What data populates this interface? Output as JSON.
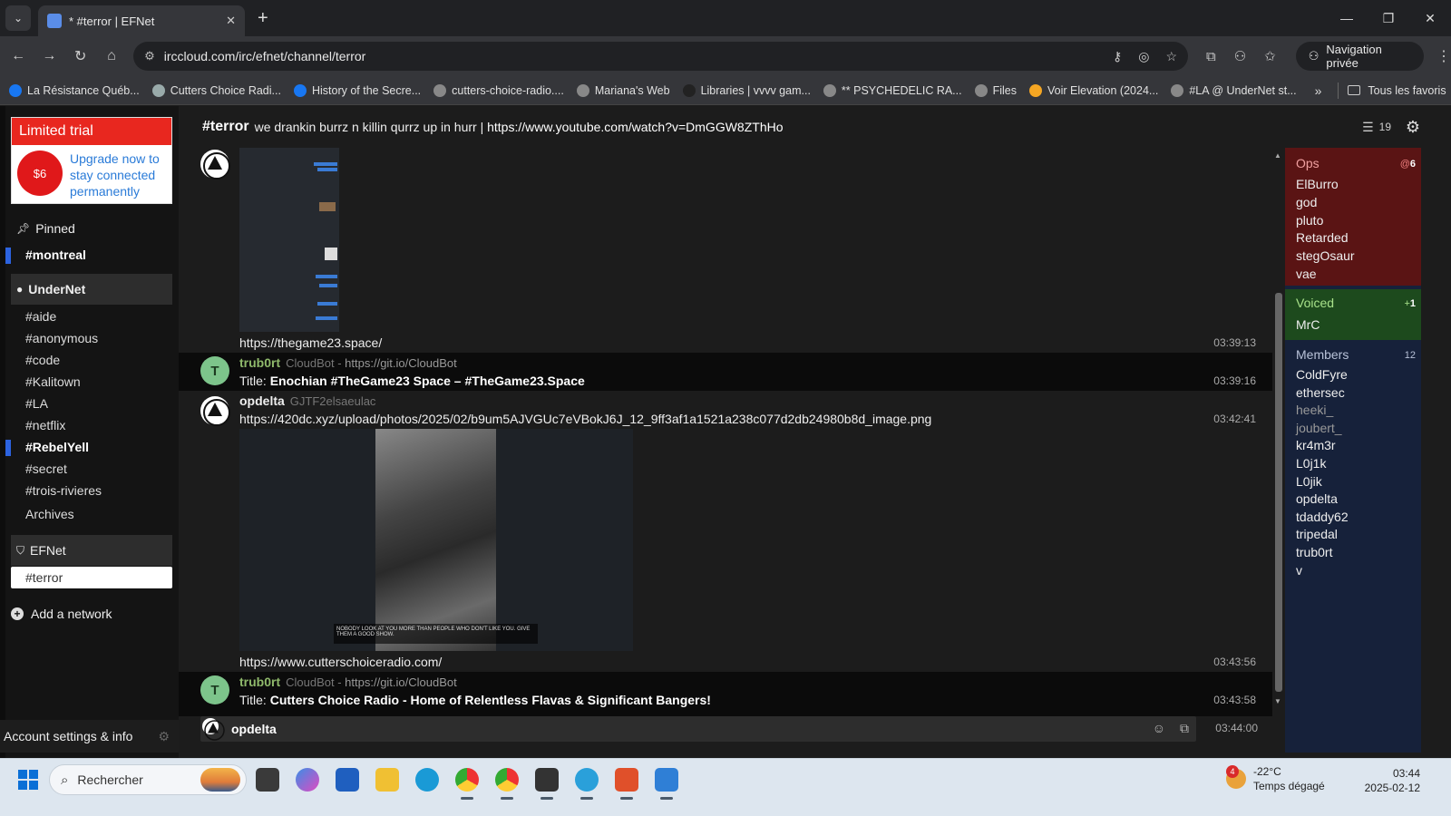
{
  "browser": {
    "tab_title": "* #terror | EFNet",
    "url": "irccloud.com/irc/efnet/channel/terror",
    "private_label": "Navigation privée",
    "bookmarks": [
      {
        "label": "La Résistance Québ...",
        "icon": "facebook-icon",
        "color": "#1877f2"
      },
      {
        "label": "Cutters Choice Radi...",
        "icon": "cloud-icon",
        "color": "#9aa"
      },
      {
        "label": "History of the Secre...",
        "icon": "facebook-icon",
        "color": "#1877f2"
      },
      {
        "label": "cutters-choice-radio....",
        "icon": "globe-icon",
        "color": "#888"
      },
      {
        "label": "Mariana's Web",
        "icon": "globe-icon",
        "color": "#888"
      },
      {
        "label": "Libraries | vvvv gam...",
        "icon": "square-icon",
        "color": "#222"
      },
      {
        "label": "** PSYCHEDELIC RA...",
        "icon": "globe-icon",
        "color": "#888"
      },
      {
        "label": "Files",
        "icon": "globe-icon",
        "color": "#888"
      },
      {
        "label": "Voir Elevation (2024...",
        "icon": "play-icon",
        "color": "#f5a623"
      },
      {
        "label": "#LA @ UnderNet st...",
        "icon": "globe-icon",
        "color": "#888"
      }
    ],
    "all_bookmarks": "Tous les favoris"
  },
  "sidebar": {
    "trial_title": "Limited trial",
    "trial_price": "$6",
    "trial_upgrade": "Upgrade now to stay connected permanently",
    "pinned_label": "Pinned",
    "pinned_channels": [
      "#montreal"
    ],
    "undernet_label": "UnderNet",
    "undernet_channels": [
      "#aide",
      "#anonymous",
      "#code",
      "#Kalitown",
      "#LA",
      "#netflix",
      "#RebelYell",
      "#secret",
      "#trois-rivieres",
      "Archives"
    ],
    "efnet_label": "EFNet",
    "efnet_channels": [
      "#terror"
    ],
    "add_network": "Add a network",
    "account": "Account settings & info"
  },
  "channel": {
    "name": "#terror",
    "topic_text": "we drankin burrz n killin qurrz up in hurr | ",
    "topic_link": "https://www.youtube.com/watch?v=DmGGW8ZThHo",
    "user_count": "19"
  },
  "messages": [
    {
      "kind": "link",
      "text": "https://thegame23.space/",
      "time": "03:39:13"
    },
    {
      "kind": "bot",
      "nick": "trub0rt",
      "ident_name": "CloudBot",
      "ident_src": "https://git.io/CloudBot",
      "title_label": "Title:",
      "title": "Enochian #TheGame23 Space – #TheGame23.Space",
      "time": "03:39:16"
    },
    {
      "kind": "user",
      "nick": "opdelta",
      "ident": "GJTF2elsaeulac",
      "text": "https://420dc.xyz/upload/photos/2025/02/b9um5AJVGUc7eVBokJ6J_12_9ff3af1a1521a238c077d2db24980b8d_image.png",
      "time": "03:42:41"
    },
    {
      "kind": "link",
      "text": "https://www.cutterschoiceradio.com/",
      "time": "03:43:56"
    },
    {
      "kind": "bot",
      "nick": "trub0rt",
      "ident_name": "CloudBot",
      "ident_src": "https://git.io/CloudBot",
      "title_label": "Title:",
      "title": "Cutters Choice Radio - Home of Relentless Flavas & Significant Bangers!",
      "time": "03:43:58"
    }
  ],
  "image_caption": "NOBODY LOOK AT YOU MORE THAN PEOPLE WHO DON'T LIKE YOU. GIVE THEM A GOOD SHOW.",
  "input": {
    "nick": "opdelta",
    "time": "03:44:00"
  },
  "members": {
    "ops_label": "Ops",
    "ops_count": "6",
    "ops": [
      "ElBurro",
      "god",
      "pluto",
      "Retarded",
      "stegOsaur",
      "vae"
    ],
    "voiced_label": "Voiced",
    "voiced_count": "1",
    "voiced": [
      "MrC"
    ],
    "members_label": "Members",
    "members_count": "12",
    "members": [
      {
        "nick": "ColdFyre",
        "away": false
      },
      {
        "nick": "ethersec",
        "away": false
      },
      {
        "nick": "heeki_",
        "away": true
      },
      {
        "nick": "joubert_",
        "away": true
      },
      {
        "nick": "kr4m3r",
        "away": false
      },
      {
        "nick": "L0j1k",
        "away": false
      },
      {
        "nick": "L0jik",
        "away": false
      },
      {
        "nick": "opdelta",
        "away": false
      },
      {
        "nick": "tdaddy62",
        "away": false
      },
      {
        "nick": "tripedal",
        "away": false
      },
      {
        "nick": "trub0rt",
        "away": false
      },
      {
        "nick": "v",
        "away": false
      }
    ]
  },
  "taskbar": {
    "search_placeholder": "Rechercher",
    "weather_temp": "-22°C",
    "weather_desc": "Temps dégagé",
    "weather_badge": "4",
    "time": "03:44",
    "date": "2025-02-12"
  }
}
